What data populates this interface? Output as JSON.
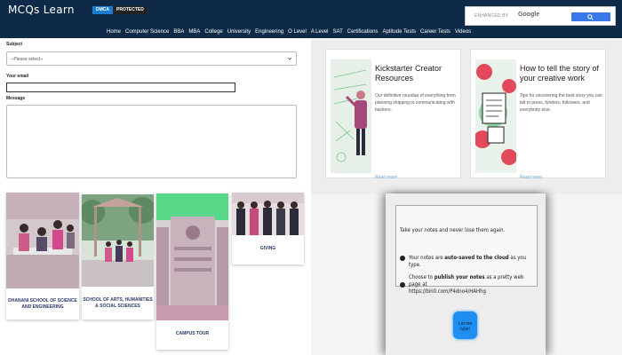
{
  "header": {
    "logo": "MCQs Learn",
    "badge_left": "DMCA",
    "badge_right": "PROTECTED",
    "search_placeholder": "ENHANCED BY",
    "search_brand": "Google",
    "nav": [
      "Home",
      "Computer Science",
      "BBA",
      "MBA",
      "College",
      "University",
      "Engineering",
      "O Level",
      "A Level",
      "SAT",
      "Certifications",
      "Aptitude Tests",
      "Career Tests",
      "Videos"
    ]
  },
  "form": {
    "subject_label": "Subject",
    "subject_value": "--Please select--",
    "email_label": "Your email",
    "message_label": "Message"
  },
  "ads": [
    {
      "title": "Kickstarter Creator Resources",
      "desc": "Our definitive roundup of everything from planning shipping to communicating with backers.",
      "link": "Read more"
    },
    {
      "title": "How to tell the story of your creative work",
      "desc": "Tips for uncovering the best story you can tell to press, funders, followers, and everybody else.",
      "link": "Read more"
    }
  ],
  "notes": {
    "line1": "Take your notes and never lose them again.",
    "bullet1_pre": "Your notes are ",
    "bullet1_bold": "auto-saved to the cloud",
    "bullet1_post": " as you type.",
    "bullet2_pre": "Choose to ",
    "bullet2_bold": "publish your notes",
    "bullet2_post": " as a pretty web page at",
    "bullet2_url": "https://bin0.com/P4dno4/HAHhg",
    "button": "Let me type!"
  },
  "tiles": [
    {
      "caption": "DHANANI SCHOOL OF SCIENCE AND ENGINEERING"
    },
    {
      "caption": "SCHOOL OF ARTS, HUMANITIES & SOCIAL SCIENCES"
    },
    {
      "caption": "CAMPUS TOUR"
    },
    {
      "caption": "GIVING"
    }
  ],
  "colors": {
    "header_bg": "#0e2a48",
    "search_button": "#3b78e7",
    "caption_text": "#2a3a6a",
    "cta_button": "#1e8ff0"
  }
}
